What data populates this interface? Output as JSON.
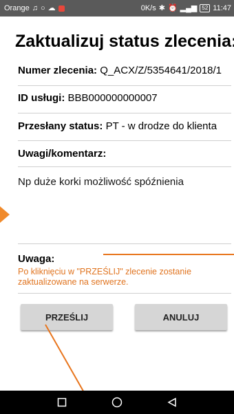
{
  "status_bar": {
    "carrier": "Orange",
    "speed": "0K/s",
    "battery": "52",
    "time": "11:47"
  },
  "form": {
    "title": "Zaktualizuj status zlecenia:",
    "order_number": {
      "label": "Numer zlecenia:",
      "value": "Q_ACX/Z/5354641/2018/1"
    },
    "service_id": {
      "label": "ID usługi:",
      "value": "BBB000000000007"
    },
    "status_sent": {
      "label": "Przesłany status:",
      "value": "PT - w drodze do klienta"
    },
    "comment": {
      "label": "Uwagi/komentarz:",
      "value": "Np duże korki możliwość spóźnienia"
    },
    "warning": {
      "label": "Uwaga:",
      "message": "Po kliknięciu w \"PRZEŚLIJ\" zlecenie zostanie zaktualizowane na serwerze."
    },
    "buttons": {
      "send": "PRZEŚLIJ",
      "cancel": "ANULUJ"
    }
  },
  "colors": {
    "warning": "#e0731e",
    "annotation": "#e8751d",
    "button_bg": "#d6d6d6"
  },
  "icons": [
    "music-icon",
    "circle-icon",
    "cloud-icon",
    "app-notification-icon",
    "bluetooth-icon",
    "alarm-icon",
    "signal-icon",
    "battery-icon",
    "nav-recent-icon",
    "nav-home-icon",
    "nav-back-icon"
  ]
}
